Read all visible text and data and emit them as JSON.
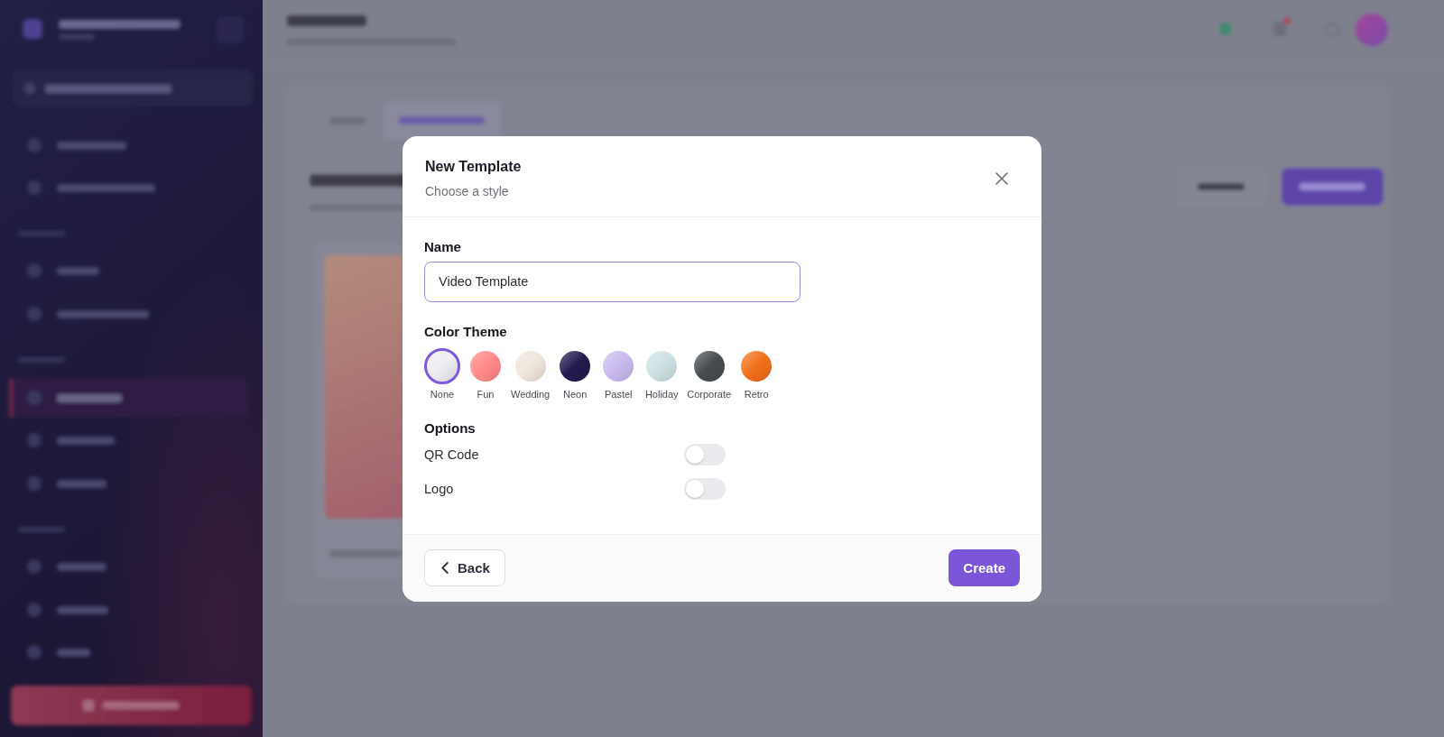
{
  "dialog": {
    "title": "New Template",
    "subtitle": "Choose a style"
  },
  "name_field": {
    "label": "Name",
    "value": "Video Template",
    "focused": true
  },
  "color_theme": {
    "label": "Color Theme",
    "themes": [
      {
        "label": "None",
        "selected": true,
        "color": "#eeeef2"
      },
      {
        "label": "Fun",
        "selected": false,
        "color": "#ff8a88"
      },
      {
        "label": "Wedding",
        "selected": false,
        "color": "#efe6dc"
      },
      {
        "label": "Neon",
        "selected": false,
        "color": "#211b4e"
      },
      {
        "label": "Pastel",
        "selected": false,
        "color": "#c9b9ee"
      },
      {
        "label": "Holiday",
        "selected": false,
        "color": "#cde0e2"
      },
      {
        "label": "Corporate",
        "selected": false,
        "color": "#464c50"
      },
      {
        "label": "Retro",
        "selected": false,
        "color": "#f26f1a"
      }
    ]
  },
  "options": {
    "label": "Options",
    "items": [
      {
        "label": "QR Code",
        "on": false
      },
      {
        "label": "Logo",
        "on": false
      }
    ]
  },
  "footer": {
    "back_button": "Back",
    "create_button": "Create"
  }
}
